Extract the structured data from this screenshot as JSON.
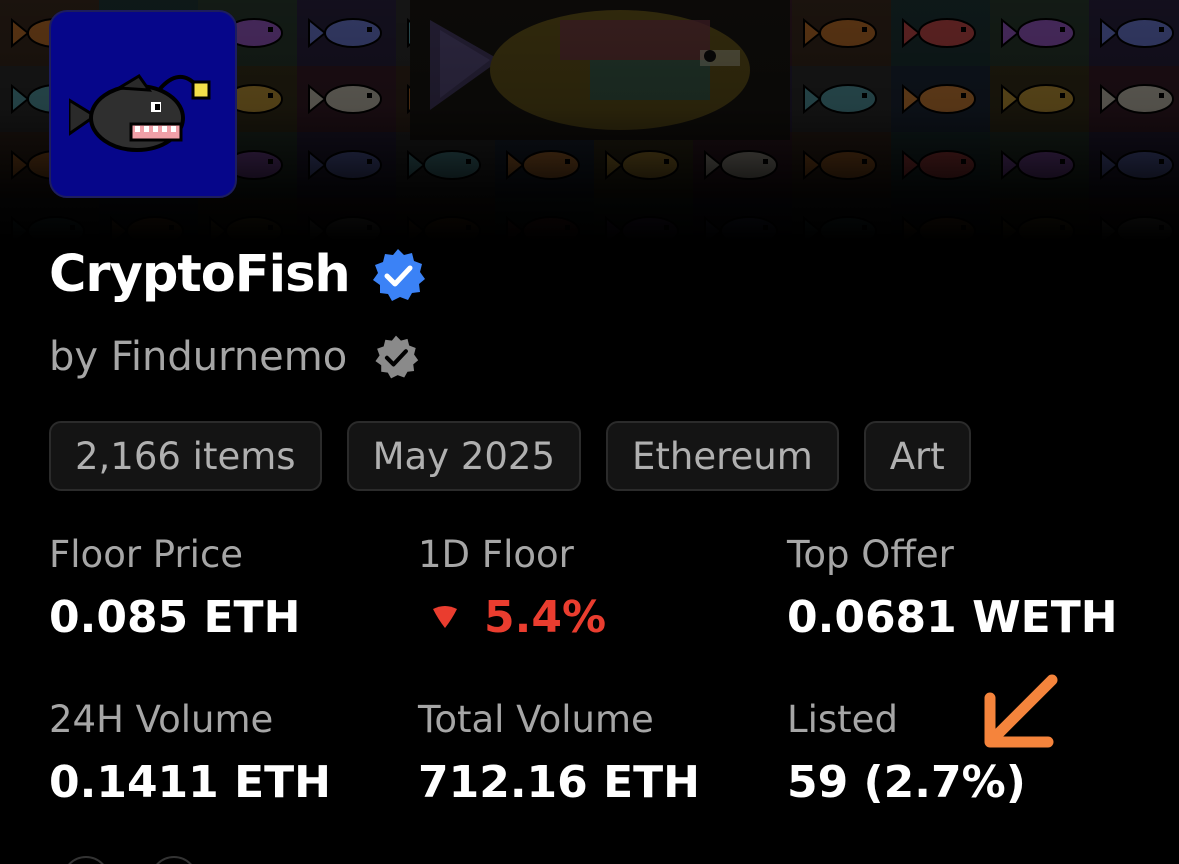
{
  "collection": {
    "name": "CryptoFish",
    "creator": "by Findurnemo"
  },
  "chips": [
    "2,166 items",
    "May 2025",
    "Ethereum",
    "Art"
  ],
  "stats": {
    "floor_price": {
      "label": "Floor Price",
      "value": "0.085 ETH"
    },
    "one_day_floor": {
      "label": "1D Floor",
      "value": "5.4%",
      "direction": "down"
    },
    "top_offer": {
      "label": "Top Offer",
      "value": "0.0681 WETH"
    },
    "volume_24h": {
      "label": "24H Volume",
      "value": "0.1411 ETH"
    },
    "total_volume": {
      "label": "Total Volume",
      "value": "712.16 ETH"
    },
    "listed": {
      "label": "Listed",
      "value": "59 (2.7%)"
    }
  },
  "icons": {
    "verified_badge": "verified-check-badge-icon",
    "creator_badge": "verified-check-badge-icon",
    "down": "caret-down-icon",
    "annotation": "arrow-down-left-icon"
  },
  "colors": {
    "background": "#000000",
    "verified_blue": "#3b82f6",
    "creator_badge_gray": "#8a8a8a",
    "negative_red": "#ea3d2f",
    "annotation_orange": "#f5843c",
    "avatar_blue": "#06068a"
  }
}
